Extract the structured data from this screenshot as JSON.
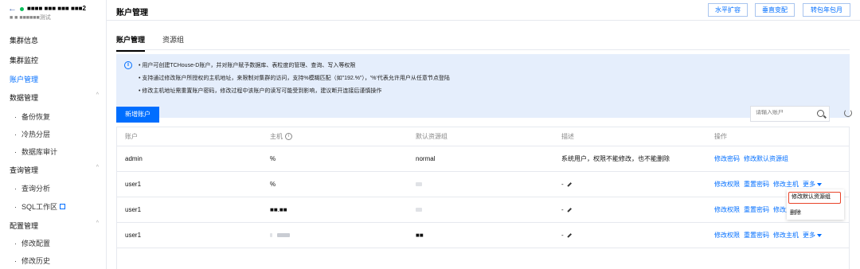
{
  "sidebar": {
    "back_glyph": "←",
    "cluster_name": "■■■■ ■■■ ■■■ ■■■2",
    "cluster_sub": "■ ■ ■■■■■■测试",
    "items": {
      "cluster_info": "集群信息",
      "cluster_monitor": "集群监控",
      "account_mgmt": "账户管理",
      "data_mgmt": "数据管理",
      "backup": "备份恢复",
      "tiering": "冷热分层",
      "audit": "数据库审计",
      "query_mgmt": "查询管理",
      "query_analysis": "查询分析",
      "sql_workspace": "SQL工作区",
      "config_mgmt": "配置管理",
      "modify_config": "修改配置",
      "modify_history": "修改历史"
    },
    "bullet": "·",
    "caret": "^"
  },
  "header": {
    "title": "账户管理",
    "buttons": [
      "水平扩容",
      "垂直变配",
      "转包年包月"
    ]
  },
  "tabs": [
    "账户管理",
    "资源组"
  ],
  "notice": {
    "icon": "i",
    "lines": [
      "• 用户可创建TCHouse-D账户，并对账户赋予数据库、表粒度的管理、查询、写入等权限",
      "• 支持通过修改账户所授权的主机地址，来限制对集群的访问，支持%模糊匹配（如\"192.%\"），'%'代表允许用户从任意节点登陆",
      "• 修改主机地址需重置账户密码，修改过程中该账户的读写可能受到影响，建议断开连接后谨慎操作"
    ]
  },
  "toolbar": {
    "add_label": "新增账户",
    "search_placeholder": "请输入账户"
  },
  "table": {
    "headers": [
      "账户",
      "主机",
      "默认资源组",
      "描述",
      "操作"
    ],
    "info_glyph": "i",
    "rows": [
      {
        "account": "admin",
        "host": "%",
        "group": "normal",
        "desc": "系统用户，权限不能修改，也不能删除",
        "actions": [
          "修改密码",
          "修改默认资源组"
        ]
      },
      {
        "account": "user1",
        "host": "%",
        "group": "",
        "desc": "-",
        "actions": [
          "修改权限",
          "重置密码",
          "修改主机",
          "更多"
        ]
      },
      {
        "account": "user1",
        "host": "■■.■■",
        "group": "",
        "desc": "-",
        "actions": [
          "修改权限",
          "重置密码",
          "修改主机"
        ]
      },
      {
        "account": "user1",
        "host": "",
        "group": "■■",
        "desc": "-",
        "actions": [
          "修改权限",
          "重置密码",
          "修改主机",
          "更多"
        ]
      }
    ]
  },
  "dropdown": {
    "items": [
      "修改默认资源组",
      "删除"
    ]
  },
  "colors": {
    "accent": "#006eff",
    "highlight_border": "#e8442a",
    "notice_bg": "#e5eefc"
  }
}
